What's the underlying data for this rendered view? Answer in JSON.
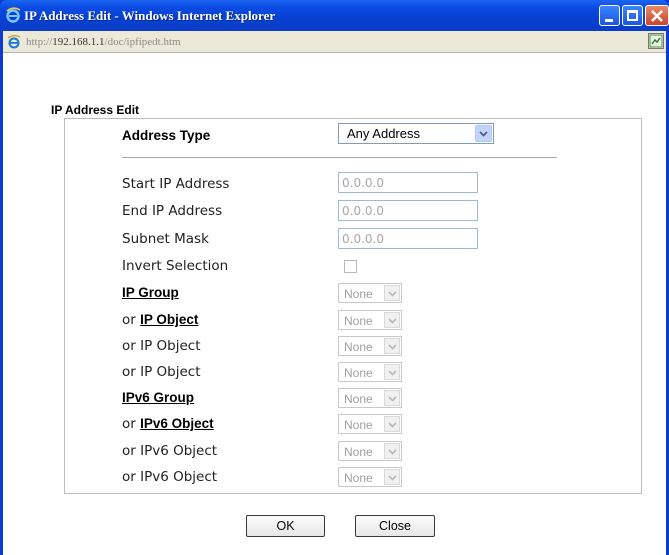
{
  "window": {
    "title": "IP Address Edit - Windows Internet Explorer"
  },
  "addressbar": {
    "url_prefix": "http://",
    "url_host": "192.168.1.1",
    "url_path": "/doc/ipfipedt.htm"
  },
  "page": {
    "section_title": "IP Address Edit",
    "address_type": {
      "label": "Address Type",
      "value": "Any Address"
    },
    "fields": [
      {
        "label": "Start IP Address",
        "value": "0.0.0.0"
      },
      {
        "label": "End IP Address",
        "value": "0.0.0.0"
      },
      {
        "label": "Subnet Mask",
        "value": "0.0.0.0"
      }
    ],
    "invert_selection": {
      "label": "Invert Selection",
      "checked": false
    },
    "groups": [
      {
        "prefix": "",
        "link": "IP Group",
        "plain": "",
        "value": "None"
      },
      {
        "prefix": "or ",
        "link": "IP Object",
        "plain": "",
        "value": "None"
      },
      {
        "prefix": "",
        "link": "",
        "plain": "or IP Object",
        "value": "None"
      },
      {
        "prefix": "",
        "link": "",
        "plain": "or IP Object",
        "value": "None"
      },
      {
        "prefix": "",
        "link": "IPv6 Group",
        "plain": "",
        "value": "None"
      },
      {
        "prefix": "or ",
        "link": "IPv6 Object",
        "plain": "",
        "value": "None"
      },
      {
        "prefix": "",
        "link": "",
        "plain": "or IPv6 Object",
        "value": "None"
      },
      {
        "prefix": "",
        "link": "",
        "plain": "or IPv6 Object",
        "value": "None"
      }
    ],
    "ok_label": "OK",
    "close_label": "Close"
  },
  "colors": {
    "titlebar": "#0a4be3",
    "frame": "#0b3bd0",
    "close_button": "#c9442a"
  },
  "icons": [
    "ie-logo-icon",
    "minimize-icon",
    "maximize-icon",
    "close-icon",
    "page-icon",
    "chevron-down-icon"
  ]
}
